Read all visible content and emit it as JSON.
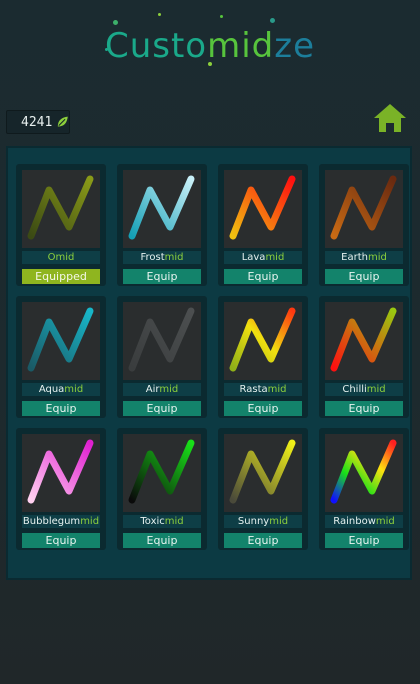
{
  "title": {
    "part1": "Custo",
    "part2": "mid",
    "part3": "ze"
  },
  "currency": {
    "amount": "4241",
    "icon": "leaf-icon"
  },
  "home_icon": "home-icon",
  "skins": [
    {
      "prefix": "",
      "suffix": "Omid",
      "button": "Equipped",
      "equipped": true,
      "colors": [
        "#3b4a14",
        "#8a9a18"
      ]
    },
    {
      "prefix": "Frost",
      "suffix": "mid",
      "button": "Equip",
      "equipped": false,
      "colors": [
        "#159fb5",
        "#c8f0f8"
      ]
    },
    {
      "prefix": "Lava",
      "suffix": "mid",
      "button": "Equip",
      "equipped": false,
      "colors": [
        "#f0c010",
        "#ff1010"
      ]
    },
    {
      "prefix": "Earth",
      "suffix": "mid",
      "button": "Equip",
      "equipped": false,
      "colors": [
        "#c86a14",
        "#6a2a10"
      ]
    },
    {
      "prefix": "Aqua",
      "suffix": "mid",
      "button": "Equip",
      "equipped": false,
      "colors": [
        "#1a5a66",
        "#18b6c8"
      ]
    },
    {
      "prefix": "Air",
      "suffix": "mid",
      "button": "Equip",
      "equipped": false,
      "colors": [
        "#3a3d3e",
        "#4c4f50"
      ]
    },
    {
      "prefix": "Rasta",
      "suffix": "mid",
      "button": "Equip",
      "equipped": false,
      "colors": [
        "#90b018",
        "#ff3810"
      ]
    },
    {
      "prefix": "Chilli",
      "suffix": "mid",
      "button": "Equip",
      "equipped": false,
      "colors": [
        "#ff1010",
        "#9ac810"
      ]
    },
    {
      "prefix": "Bubblegum",
      "suffix": "mid",
      "button": "Equip",
      "equipped": false,
      "colors": [
        "#ffd0f0",
        "#e020d0"
      ]
    },
    {
      "prefix": "Toxic",
      "suffix": "mid",
      "button": "Equip",
      "equipped": false,
      "colors": [
        "#0a0a0a",
        "#18e018"
      ]
    },
    {
      "prefix": "Sunny",
      "suffix": "mid",
      "button": "Equip",
      "equipped": false,
      "colors": [
        "#4a4a3a",
        "#f0f018"
      ]
    },
    {
      "prefix": "Rainbow",
      "suffix": "mid",
      "button": "Equip",
      "equipped": false,
      "colors": [
        "#1010ff",
        "#ff2020"
      ]
    }
  ]
}
